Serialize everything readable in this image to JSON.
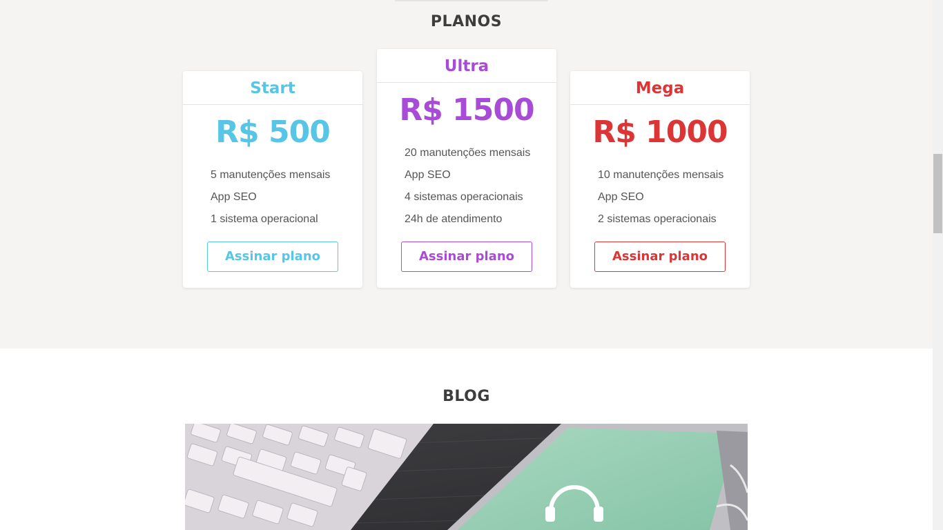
{
  "planos": {
    "title": "PLANOS",
    "plans": [
      {
        "name": "Start",
        "price": "R$ 500",
        "features": [
          "5 manutenções mensais",
          "App SEO",
          "1 sistema operacional"
        ],
        "button_label": "Assinar plano",
        "color": "#56c5e6"
      },
      {
        "name": "Ultra",
        "price": "R$ 1500",
        "features": [
          "20 manutenções mensais",
          "App SEO",
          "4 sistemas operacionais",
          "24h de atendimento"
        ],
        "button_label": "Assinar plano",
        "color": "#a84bd6"
      },
      {
        "name": "Mega",
        "price": "R$ 1000",
        "features": [
          "10 manutenções mensais",
          "App SEO",
          "2 sistemas operacionais"
        ],
        "button_label": "Assinar plano",
        "color": "#dc3535"
      }
    ]
  },
  "blog": {
    "title": "BLOG",
    "image_icon": "headphones-icon"
  }
}
